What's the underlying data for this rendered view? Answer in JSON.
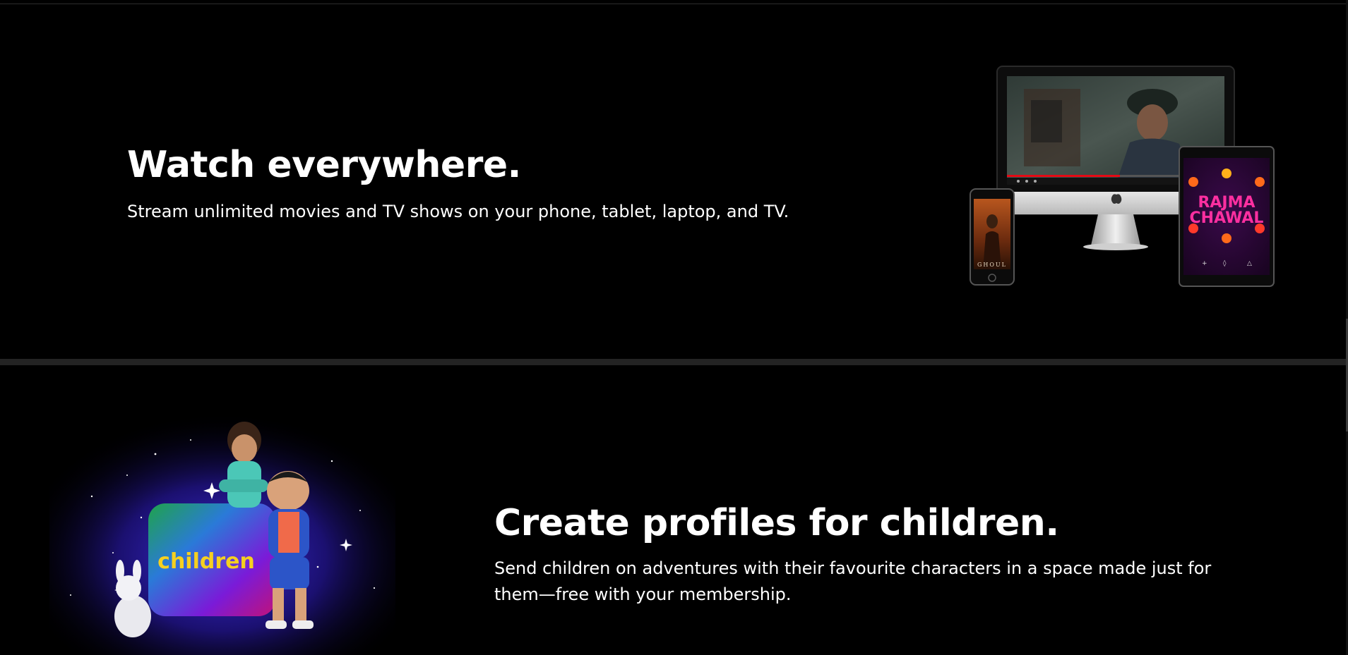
{
  "watch": {
    "title": "Watch everywhere.",
    "description": "Stream unlimited movies and TV shows on your phone, tablet, laptop, and TV.",
    "phone_poster_text": "GHOUL",
    "tablet_poster_line1": "RAJMA",
    "tablet_poster_line2": "CHAWAL"
  },
  "kids": {
    "title": "Create profiles for children.",
    "description": "Send children on adventures with their favourite characters in a space made just for them—free with your membership.",
    "badge_text": "children"
  },
  "colors": {
    "background": "#000000",
    "divider": "#232323",
    "text": "#ffffff",
    "kids_badge_text": "#f5d020",
    "tablet_accent": "#ff2fa0"
  }
}
